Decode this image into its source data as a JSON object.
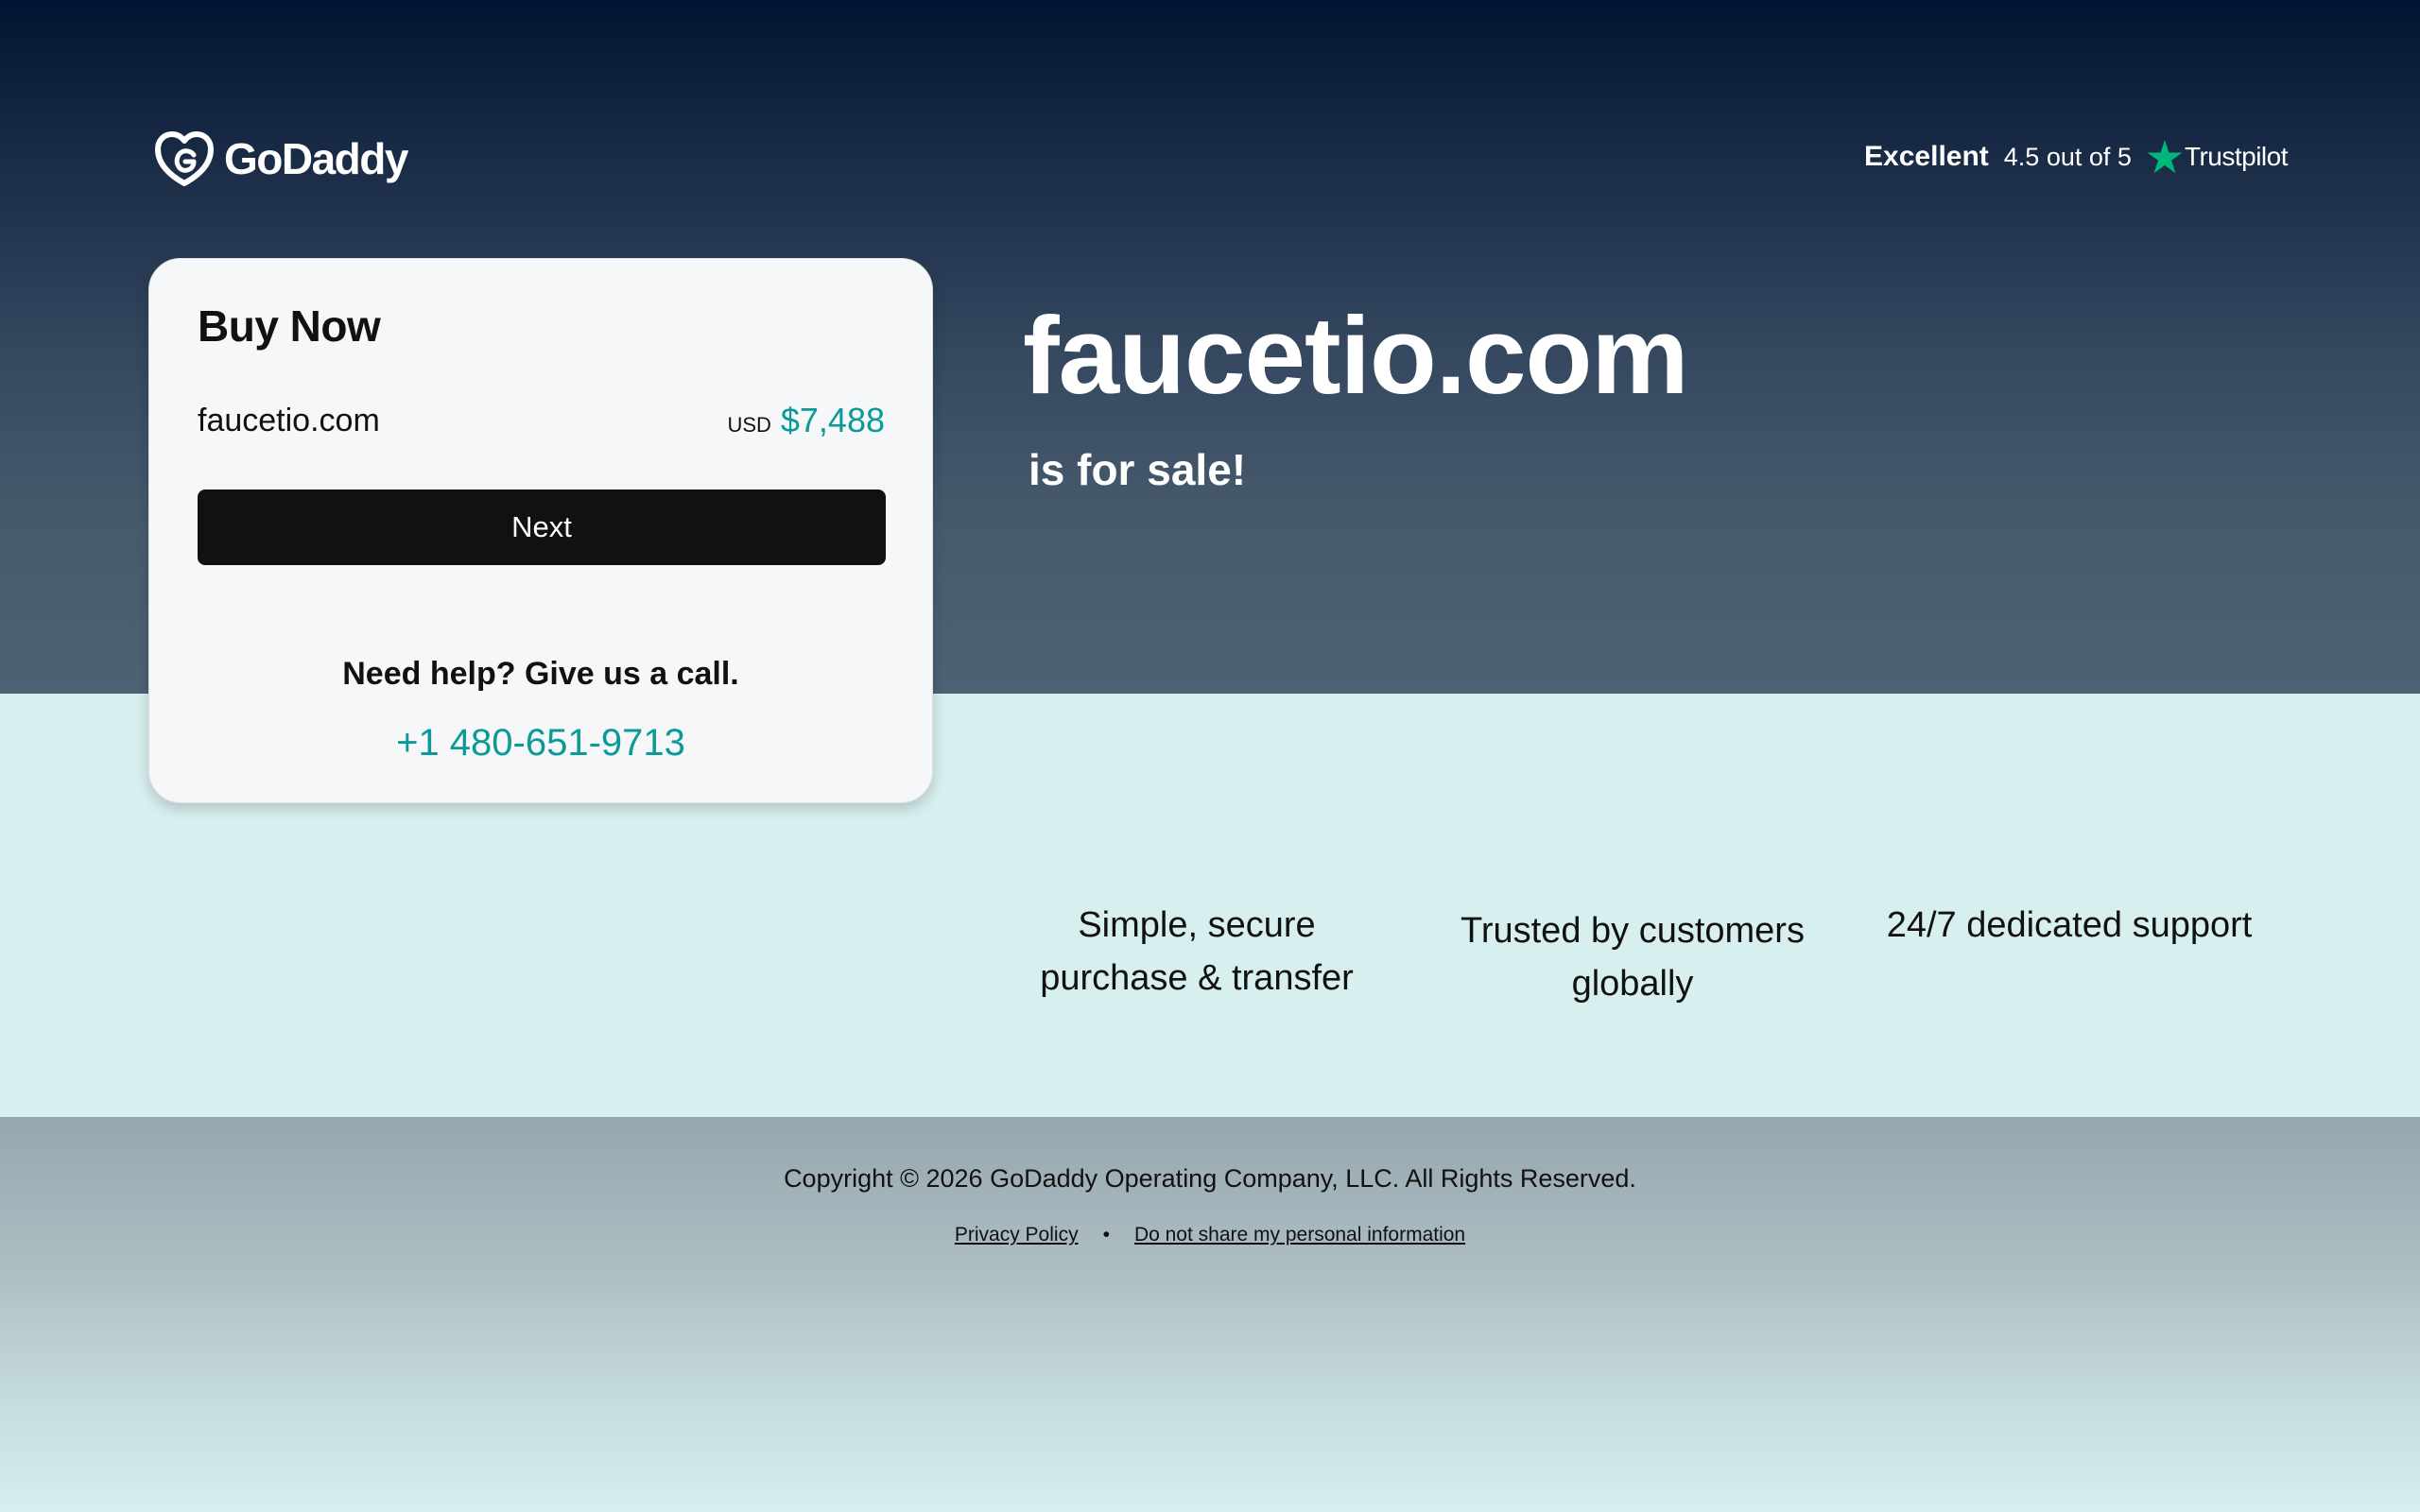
{
  "brand": {
    "name": "GoDaddy"
  },
  "trustpilot": {
    "label": "Excellent",
    "rating": "4.5 out of 5",
    "brand": "Trustpilot",
    "star_color": "#00b67a"
  },
  "buy_card": {
    "title": "Buy Now",
    "domain": "faucetio.com",
    "currency": "USD",
    "price": "$7,488",
    "next_label": "Next",
    "help_title": "Need help? Give us a call.",
    "phone": "+1 480-651-9713"
  },
  "hero": {
    "domain": "faucetio.com",
    "tagline": "is for sale!"
  },
  "features": [
    {
      "line1": "Simple, secure",
      "line2": "purchase & transfer"
    },
    {
      "line1": "Trusted by customers",
      "line2": "globally"
    },
    {
      "line1": "24/7 dedicated support"
    }
  ],
  "footer": {
    "copyright": "Copyright © 2026 GoDaddy Operating Company, LLC. All Rights Reserved.",
    "privacy_label": "Privacy Policy",
    "separator": "•",
    "do_not_share_label": "Do not share my personal information"
  },
  "colors": {
    "accent": "#0b9a97",
    "hero_top": "#021431",
    "mid_band": "#d8efef"
  }
}
